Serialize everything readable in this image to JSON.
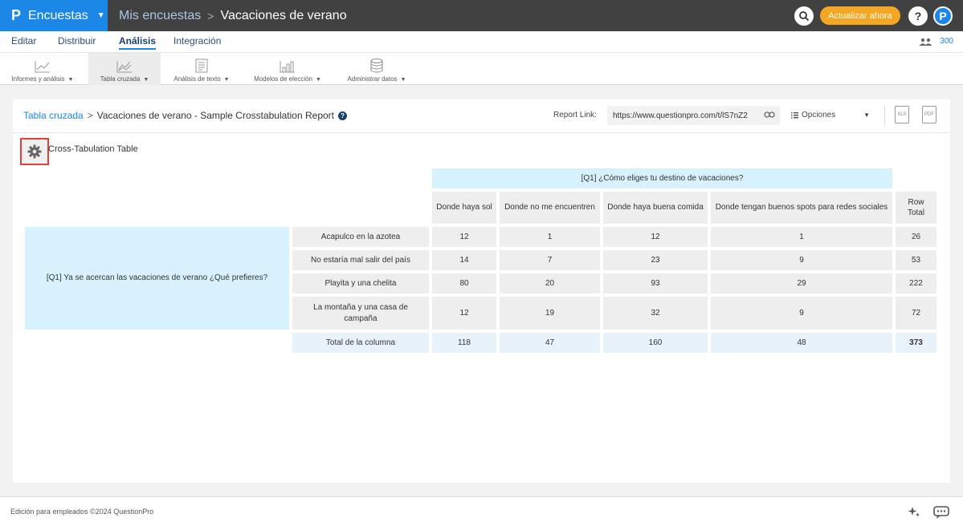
{
  "header": {
    "brand_logo": "P",
    "brand_name": "Encuestas",
    "breadcrumb_parent": "Mis encuestas",
    "breadcrumb_sep": ">",
    "breadcrumb_current": "Vacaciones de verano",
    "upgrade_label": "Actualizar ahora",
    "help_label": "?",
    "profile_initial": "P"
  },
  "nav": {
    "tabs": [
      "Editar",
      "Distribuir",
      "Análisis",
      "Integración"
    ],
    "active_tab": "Análisis",
    "users_count": "300"
  },
  "toolbar": {
    "items": [
      {
        "label": "Informes y análisis",
        "icon": "line-chart-icon"
      },
      {
        "label": "Tabla cruzada",
        "icon": "crosstab-chart-icon"
      },
      {
        "label": "Análisis de texto",
        "icon": "text-analysis-icon"
      },
      {
        "label": "Modelos de elección",
        "icon": "bar-chart-icon"
      },
      {
        "label": "Administrar datos",
        "icon": "database-icon"
      }
    ],
    "active": "Tabla cruzada"
  },
  "panel": {
    "crumb_link": "Tabla cruzada",
    "crumb_sep": ">",
    "report_title": "Vacaciones de verano - Sample Crosstabulation Report",
    "report_link_label": "Report Link:",
    "report_link_value": "https://www.questionpro.com/t/lS7nZ2",
    "options_label": "Opciones",
    "xls_label": "XLS",
    "pdf_label": "PDF"
  },
  "table": {
    "caption": "Cross-Tabulation Table",
    "column_question": "[Q1] ¿Cómo eliges tu destino de vacaciones?",
    "column_headers": [
      "Donde haya sol",
      "Donde no me encuentren",
      "Donde haya buena comida",
      "Donde tengan buenos spots para redes sociales"
    ],
    "row_total_header": "Row Total",
    "row_question": "[Q1] Ya se acercan las vacaciones de verano ¿Qué prefieres?",
    "rows": [
      {
        "label": "Acapulco en la azotea",
        "values": [
          "12",
          "1",
          "12",
          "1"
        ],
        "total": "26"
      },
      {
        "label": "No estaría mal salir del país",
        "values": [
          "14",
          "7",
          "23",
          "9"
        ],
        "total": "53"
      },
      {
        "label": "Playita y una chelita",
        "values": [
          "80",
          "20",
          "93",
          "29"
        ],
        "total": "222"
      },
      {
        "label": "La montaña y una casa de campaña",
        "values": [
          "12",
          "19",
          "32",
          "9"
        ],
        "total": "72"
      }
    ],
    "column_total": {
      "label": "Total de la columna",
      "values": [
        "118",
        "47",
        "160",
        "48"
      ],
      "total": "373"
    }
  },
  "footer": {
    "text": "Edición para empleados ©2024 QuestionPro"
  },
  "colors": {
    "brand_blue": "#1b87e6",
    "topbar": "#414141",
    "upgrade_orange": "#f5a623",
    "highlight_red": "#e0403a",
    "light_blue": "#d8f2fd"
  }
}
